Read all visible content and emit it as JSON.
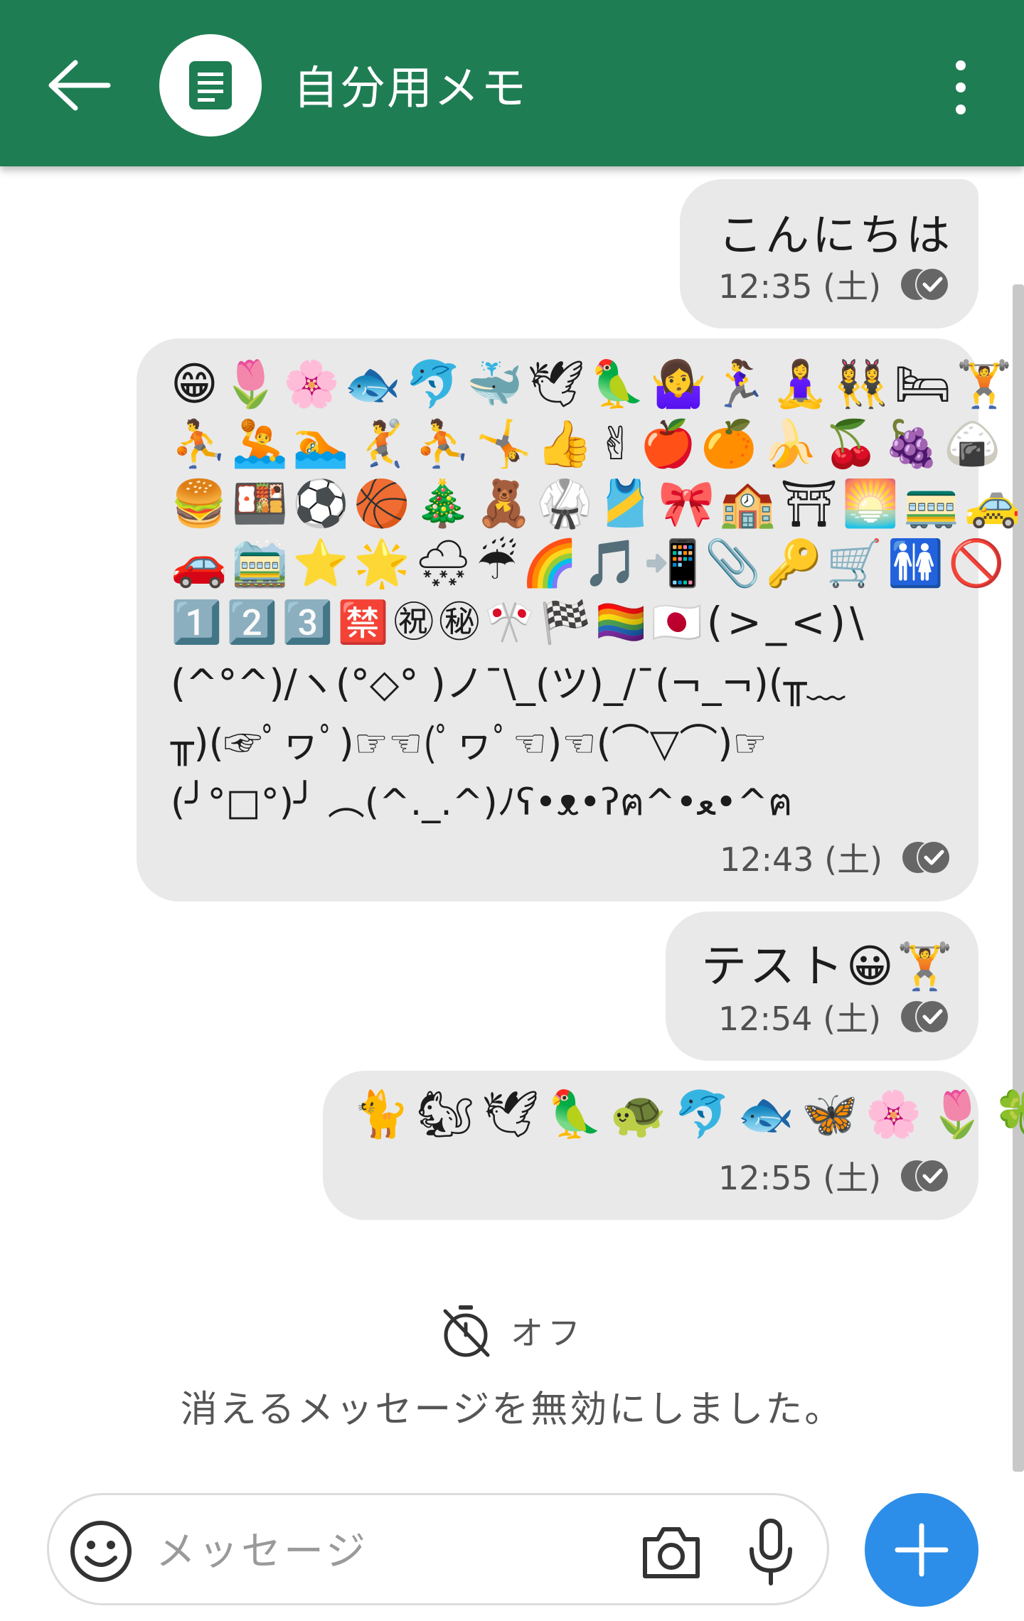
{
  "header": {
    "title": "自分用メモ",
    "background": "#1f7d53",
    "icons": [
      "arrow-left-icon",
      "note-icon",
      "more-vert-icon"
    ]
  },
  "messages": [
    {
      "text": "こんにちは",
      "time": "12:35 (土)",
      "status_icon": "read-check-icon"
    },
    {
      "lines": [
        "😁🌷🌸🐟🐬🐳🕊🦜🤷‍♀️🏃‍♀️🧘‍♀️👯‍♀️🛏🏋",
        "⛹🤽🏊🤾⛹🤸👍✌🍎🍊🍌🍒🍇🍙",
        "🍔🍱⚽🏀🎄🧸🥋🎽🎀🏫⛩🌅🚃🚕",
        "🚗🚞⭐🌟🌨☔🌈🎵📲📎🔑🛒🚻🚫",
        "1️⃣2️⃣3️⃣🈲㊗㊙🎌🏁🏳️‍🌈🇯🇵(>_<)\\",
        "(^°^)/ヽ(°◇° )ノ¯\\_(ツ)_/¯(¬_¬)(╥﹏",
        "╥)(☞ﾟヮﾟ)☞☜(ﾟヮﾟ☜)☜(⌒▽⌒)☞",
        "(╯°□°)╯ ︵(^._.^)ﾉʕ•ᴥ•ʔฅ^•ﻌ•^ฅ"
      ],
      "time": "12:43 (土)",
      "status_icon": "read-check-icon"
    },
    {
      "text": "テスト😀🏋",
      "time": "12:54 (土)",
      "status_icon": "read-check-icon"
    },
    {
      "text": "🐈🐿🕊🦜🐢🐬🐟🦋🌸🌷🍀",
      "time": "12:55 (土)",
      "status_icon": "read-check-icon"
    }
  ],
  "disappearing": {
    "icon": "timer-off-icon",
    "label": "オフ",
    "notice": "消えるメッセージを無効にしました。"
  },
  "composer": {
    "placeholder": "メッセージ",
    "icons": [
      "smiley-icon",
      "camera-icon",
      "mic-icon",
      "plus-icon"
    ],
    "send_button_color": "#2c8ee8"
  }
}
